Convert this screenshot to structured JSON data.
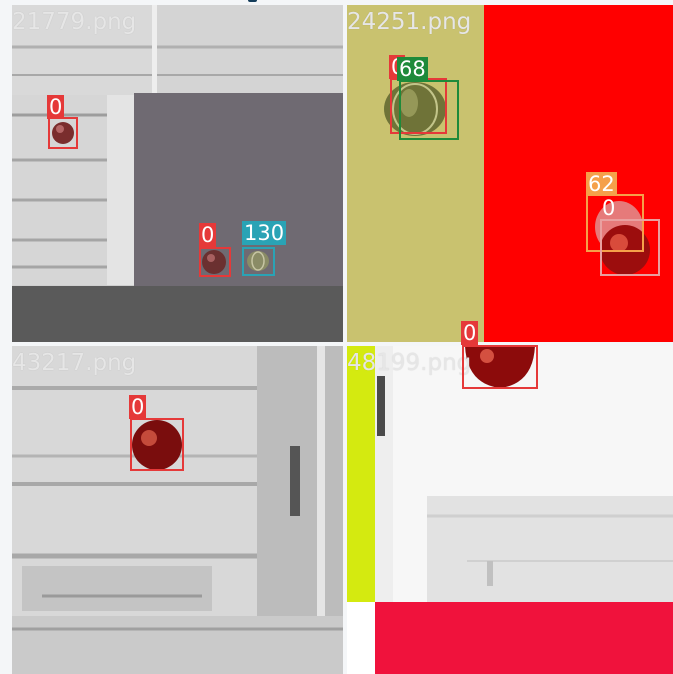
{
  "mosaic": {
    "tiles": [
      {
        "filename": "21779.png"
      },
      {
        "filename": "24251.png"
      },
      {
        "filename": "43217.png"
      },
      {
        "filename": "48199.png"
      }
    ]
  },
  "detections": [
    {
      "label": "0",
      "color": "#e53939"
    },
    {
      "label": "0",
      "color": "#e53939"
    },
    {
      "label": "130",
      "color": "#2aa3b5"
    },
    {
      "label": "0",
      "color": "#e53939"
    },
    {
      "label": "68",
      "color": "#1e8a3a"
    },
    {
      "label": "62",
      "color": "#f5a04a"
    },
    {
      "label": "0",
      "color": "#e53939"
    },
    {
      "label": "0",
      "color": "#e53939"
    },
    {
      "label": "0",
      "color": "#e53939"
    }
  ],
  "colors": {
    "khaki_panel": "#c9c26f",
    "red_panel": "#ff0000",
    "gray_panel": "#6f6a72",
    "lime_bar": "#d4ea10",
    "crimson_bar": "#f0123c"
  }
}
